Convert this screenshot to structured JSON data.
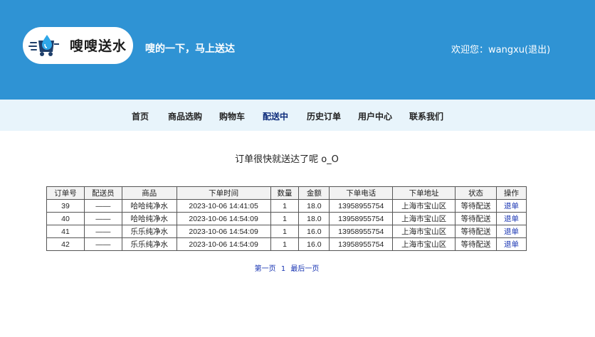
{
  "header": {
    "brand": "嗖嗖送水",
    "slogan": "嗖的一下，马上送达",
    "welcome_prefix": "欢迎您：",
    "username": "wangxu",
    "logout": "(退出)"
  },
  "nav": [
    {
      "label": "首页",
      "active": false
    },
    {
      "label": "商品选购",
      "active": false
    },
    {
      "label": "购物车",
      "active": false
    },
    {
      "label": "配送中",
      "active": true
    },
    {
      "label": "历史订单",
      "active": false
    },
    {
      "label": "用户中心",
      "active": false
    },
    {
      "label": "联系我们",
      "active": false
    }
  ],
  "notice": "订单很快就送达了呢 o_O",
  "table": {
    "columns": [
      "订单号",
      "配送员",
      "商品",
      "下单时间",
      "数量",
      "金额",
      "下单电话",
      "下单地址",
      "状态",
      "操作"
    ],
    "rows": [
      [
        "39",
        "——",
        "哈哈纯净水",
        "2023-10-06 14:41:05",
        "1",
        "18.0",
        "13958955754",
        "上海市宝山区",
        "等待配送",
        "退单"
      ],
      [
        "40",
        "——",
        "哈哈纯净水",
        "2023-10-06 14:54:09",
        "1",
        "18.0",
        "13958955754",
        "上海市宝山区",
        "等待配送",
        "退单"
      ],
      [
        "41",
        "——",
        "乐乐纯净水",
        "2023-10-06 14:54:09",
        "1",
        "16.0",
        "13958955754",
        "上海市宝山区",
        "等待配送",
        "退单"
      ],
      [
        "42",
        "——",
        "乐乐纯净水",
        "2023-10-06 14:54:09",
        "1",
        "16.0",
        "13958955754",
        "上海市宝山区",
        "等待配送",
        "退单"
      ]
    ]
  },
  "pager": {
    "first": "第一页",
    "current": "1",
    "last": "最后一页"
  },
  "colors": {
    "header_bg": "#2f93d4",
    "nav_bg": "#e8f4fb",
    "link": "#1a36b3",
    "active_nav": "#0b2a7a"
  },
  "icons": {
    "logo": "water-delivery-truck-icon"
  }
}
